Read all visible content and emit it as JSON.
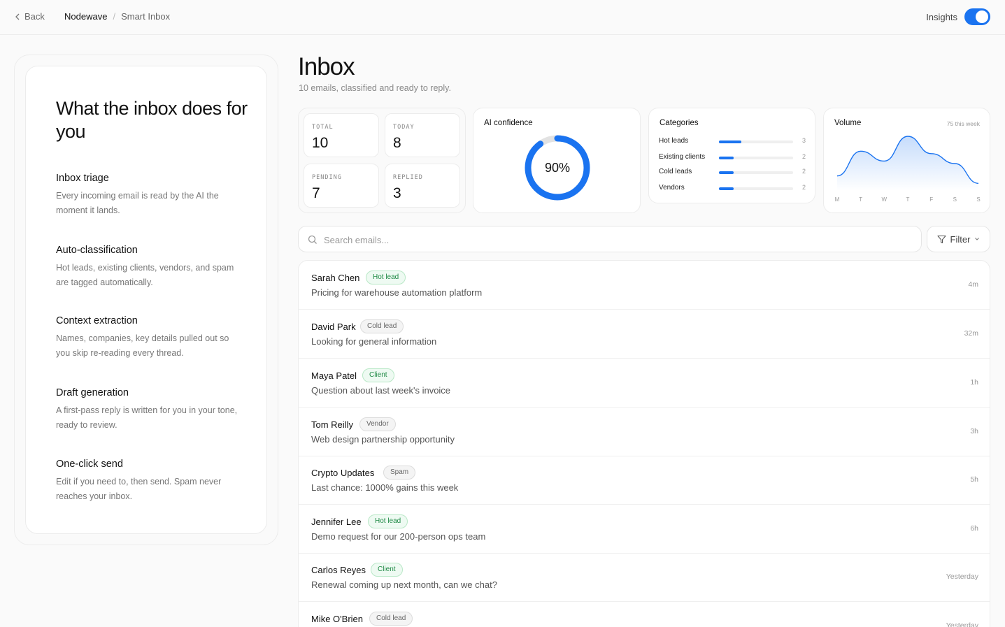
{
  "topbar": {
    "back_label": "Back",
    "breadcrumb": [
      "Nodewave",
      "Smart Inbox"
    ],
    "insights_label": "Insights",
    "insights_on": true
  },
  "left": {
    "title": "What the inbox does for you",
    "features": [
      {
        "title": "Inbox triage",
        "desc": "Every incoming email is read by the AI the moment it lands."
      },
      {
        "title": "Auto-classification",
        "desc": "Hot leads, existing clients, vendors, and spam are tagged automatically."
      },
      {
        "title": "Context extraction",
        "desc": "Names, companies, key details pulled out so you skip re-reading every thread."
      },
      {
        "title": "Draft generation",
        "desc": "A first-pass reply is written for you in your tone, ready to review."
      },
      {
        "title": "One-click send",
        "desc": "Edit if you need to, then send. Spam never reaches your inbox."
      }
    ]
  },
  "main": {
    "title": "Inbox",
    "subtitle": "10 emails, classified and ready to reply."
  },
  "stats": [
    {
      "label": "TOTAL",
      "value": "10"
    },
    {
      "label": "TODAY",
      "value": "8"
    },
    {
      "label": "PENDING",
      "value": "7"
    },
    {
      "label": "REPLIED",
      "value": "3"
    }
  ],
  "confidence": {
    "title": "AI confidence",
    "value_label": "90%",
    "value": 0.9
  },
  "categories": {
    "title": "Categories",
    "items": [
      {
        "name": "Hot leads",
        "count": "3",
        "fraction": 0.3
      },
      {
        "name": "Existing clients",
        "count": "2",
        "fraction": 0.2
      },
      {
        "name": "Cold leads",
        "count": "2",
        "fraction": 0.2
      },
      {
        "name": "Vendors",
        "count": "2",
        "fraction": 0.2
      }
    ]
  },
  "volume": {
    "title": "Volume",
    "meta": "75 this week",
    "days": [
      "M",
      "T",
      "W",
      "T",
      "F",
      "S",
      "S"
    ],
    "values": [
      6,
      16,
      12,
      22,
      15,
      11,
      3
    ]
  },
  "search": {
    "placeholder": "Search emails..."
  },
  "filter": {
    "label": "Filter"
  },
  "emails": [
    {
      "sender": "Sarah Chen",
      "tag": "Hot lead",
      "tag_color": "green",
      "subject": "Pricing for warehouse automation platform",
      "time": "4m"
    },
    {
      "sender": "David Park",
      "tag": "Cold lead",
      "tag_color": "gray",
      "subject": "Looking for general information",
      "time": "32m"
    },
    {
      "sender": "Maya Patel",
      "tag": "Client",
      "tag_color": "green",
      "subject": "Question about last week's invoice",
      "time": "1h"
    },
    {
      "sender": "Tom Reilly",
      "tag": "Vendor",
      "tag_color": "gray",
      "subject": "Web design partnership opportunity",
      "time": "3h"
    },
    {
      "sender": "Crypto Updates",
      "tag": "Spam",
      "tag_color": "gray",
      "subject": "Last chance: 1000% gains this week",
      "time": "5h"
    },
    {
      "sender": "Jennifer Lee",
      "tag": "Hot lead",
      "tag_color": "green",
      "subject": "Demo request for our 200-person ops team",
      "time": "6h"
    },
    {
      "sender": "Carlos Reyes",
      "tag": "Client",
      "tag_color": "green",
      "subject": "Renewal coming up next month, can we chat?",
      "time": "Yesterday"
    },
    {
      "sender": "Mike O'Brien",
      "tag": "Cold lead",
      "tag_color": "gray",
      "subject": "",
      "time": "Yesterday"
    }
  ],
  "colors": {
    "accent": "#1a73f0",
    "tag_green": "#1f8a45",
    "tag_gray": "#666666"
  }
}
